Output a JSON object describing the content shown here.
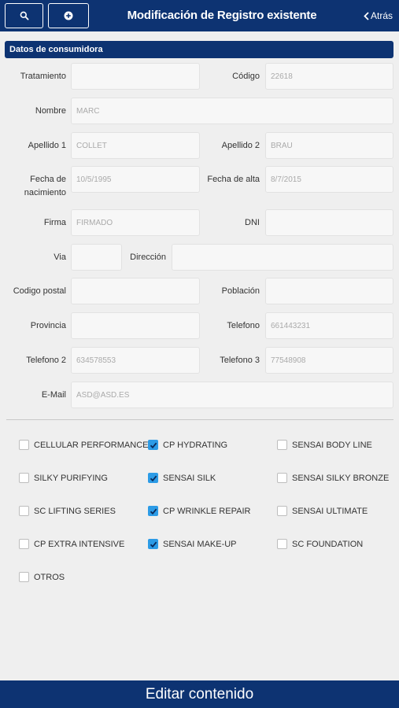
{
  "header": {
    "title": "Modificación de Registro existente",
    "back_label": "Atrás",
    "search_icon": "search-icon",
    "add_icon": "plus-circle-icon"
  },
  "section": {
    "title": "Datos de consumidora"
  },
  "form": {
    "tratamiento": {
      "label": "Tratamiento",
      "value": ""
    },
    "codigo": {
      "label": "Código",
      "value": "22618"
    },
    "nombre": {
      "label": "Nombre",
      "value": "MARC"
    },
    "apellido1": {
      "label": "Apellido 1",
      "value": "COLLET"
    },
    "apellido2": {
      "label": "Apellido 2",
      "value": "BRAU"
    },
    "fecha_nacimiento": {
      "label_line1": "Fecha de",
      "label_line2": "nacimiento",
      "value": "10/5/1995"
    },
    "fecha_alta": {
      "label": "Fecha de alta",
      "value": "8/7/2015"
    },
    "firma": {
      "label": "Firma",
      "value": "FIRMADO"
    },
    "dni": {
      "label": "DNI",
      "value": ""
    },
    "via": {
      "label": "Via",
      "value": ""
    },
    "direccion": {
      "label": "Dirección",
      "value": ""
    },
    "codigo_postal": {
      "label": "Codigo postal",
      "value": ""
    },
    "poblacion": {
      "label": "Población",
      "value": ""
    },
    "provincia": {
      "label": "Provincia",
      "value": ""
    },
    "telefono": {
      "label": "Telefono",
      "value": "661443231"
    },
    "telefono2": {
      "label": "Telefono 2",
      "value": "634578553"
    },
    "telefono3": {
      "label": "Telefono 3",
      "value": "77548908"
    },
    "email": {
      "label": "E-Mail",
      "value": "ASD@ASD.ES"
    }
  },
  "products": [
    {
      "label": "CELLULAR PERFORMANCE",
      "checked": false
    },
    {
      "label": "CP HYDRATING",
      "checked": true
    },
    {
      "label": "SENSAI BODY LINE",
      "checked": false
    },
    {
      "label": "SILKY PURIFYING",
      "checked": false
    },
    {
      "label": "SENSAI SILK",
      "checked": true
    },
    {
      "label": "SENSAI SILKY BRONZE",
      "checked": false
    },
    {
      "label": "SC LIFTING SERIES",
      "checked": false
    },
    {
      "label": "CP WRINKLE REPAIR",
      "checked": true
    },
    {
      "label": "SENSAI ULTIMATE",
      "checked": false
    },
    {
      "label": "CP EXTRA INTENSIVE",
      "checked": false
    },
    {
      "label": "SENSAI MAKE-UP",
      "checked": true
    },
    {
      "label": "SC FOUNDATION",
      "checked": false
    },
    {
      "label": "OTROS",
      "checked": false
    }
  ],
  "footer": {
    "button_label": "Editar contenido"
  },
  "colors": {
    "brand": "#0d3372",
    "checkbox_on": "#2c9be6",
    "background": "#efefef"
  }
}
